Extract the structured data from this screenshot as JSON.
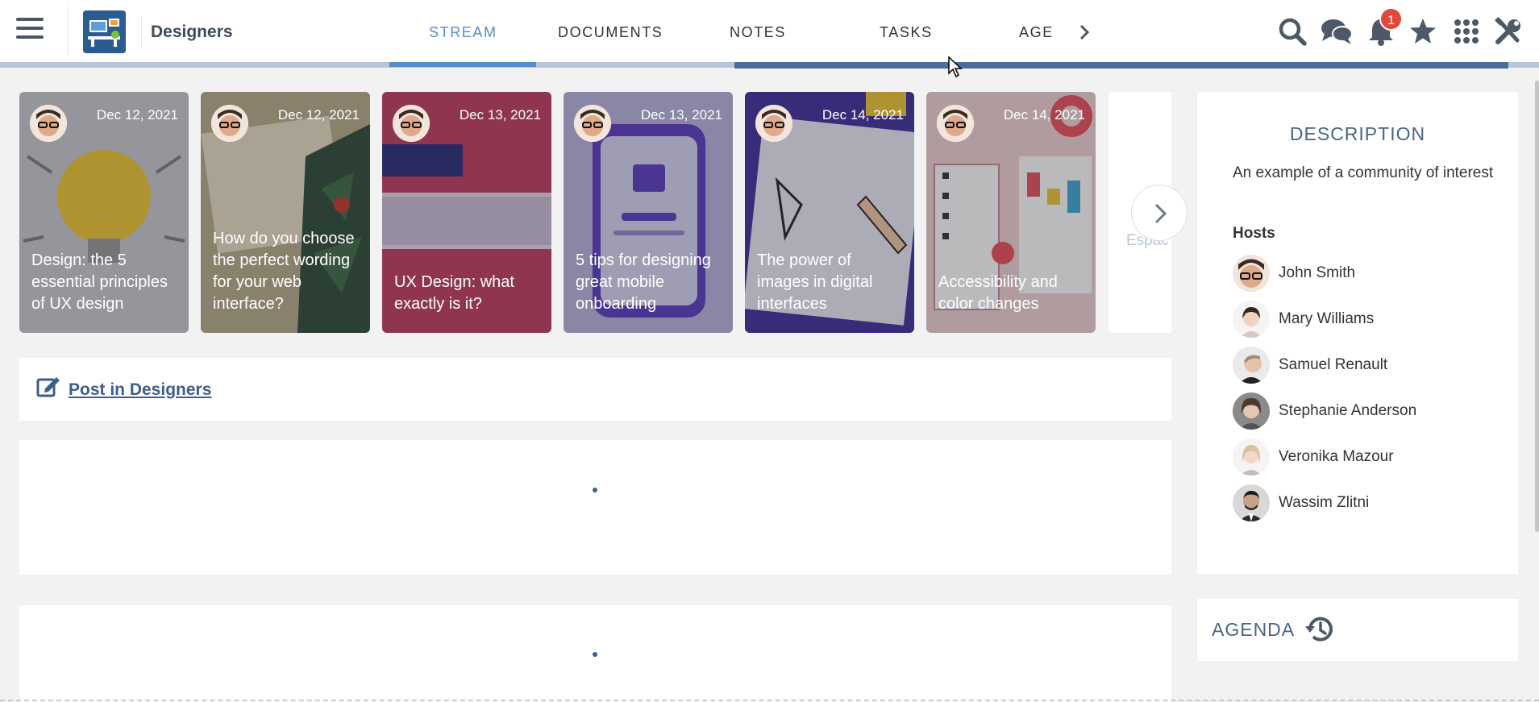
{
  "header": {
    "space_name": "Designers",
    "tabs": [
      {
        "label": "STREAM",
        "active": true
      },
      {
        "label": "DOCUMENTS",
        "active": false
      },
      {
        "label": "NOTES",
        "active": false
      },
      {
        "label": "TASKS",
        "active": false
      },
      {
        "label": "AGE",
        "active": false
      }
    ],
    "notification_count": "1",
    "icons": [
      "menu-icon",
      "search-icon",
      "chat-icon",
      "bell-icon",
      "star-icon",
      "apps-grid-icon",
      "tools-icon"
    ]
  },
  "carousel": {
    "items": [
      {
        "date": "Dec 12, 2021",
        "title": "Design: the 5 essential principles of UX design",
        "color": "#c9cbcf"
      },
      {
        "date": "Dec 12, 2021",
        "title": "How do you choose the perfect wording for your web interface?",
        "color": "#8f8468"
      },
      {
        "date": "Dec 13, 2021",
        "title": "UX Design: what exactly is it?",
        "color": "#c23b5e"
      },
      {
        "date": "Dec 13, 2021",
        "title": "5 tips for designing great mobile onboarding",
        "color": "#a9a6d6"
      },
      {
        "date": "Dec 14, 2021",
        "title": "The power of images in digital interfaces",
        "color": "#3d2f9b"
      },
      {
        "date": "Dec 14, 2021",
        "title": "Accessibility and color changes",
        "color": "#d8b4b4"
      }
    ],
    "partial_label": "Espac"
  },
  "composer": {
    "post_label": "Post in Designers"
  },
  "description": {
    "title": "DESCRIPTION",
    "text": "An example of a community of interest",
    "hosts_label": "Hosts",
    "hosts": [
      "John Smith",
      "Mary Williams",
      "Samuel Renault",
      "Stephanie Anderson",
      "Veronika Mazour",
      "Wassim Zlitni"
    ]
  },
  "agenda": {
    "title": "AGENDA"
  },
  "colors": {
    "accent": "#578dc9",
    "brand": "#3f5d8c",
    "badge": "#e2483a"
  }
}
